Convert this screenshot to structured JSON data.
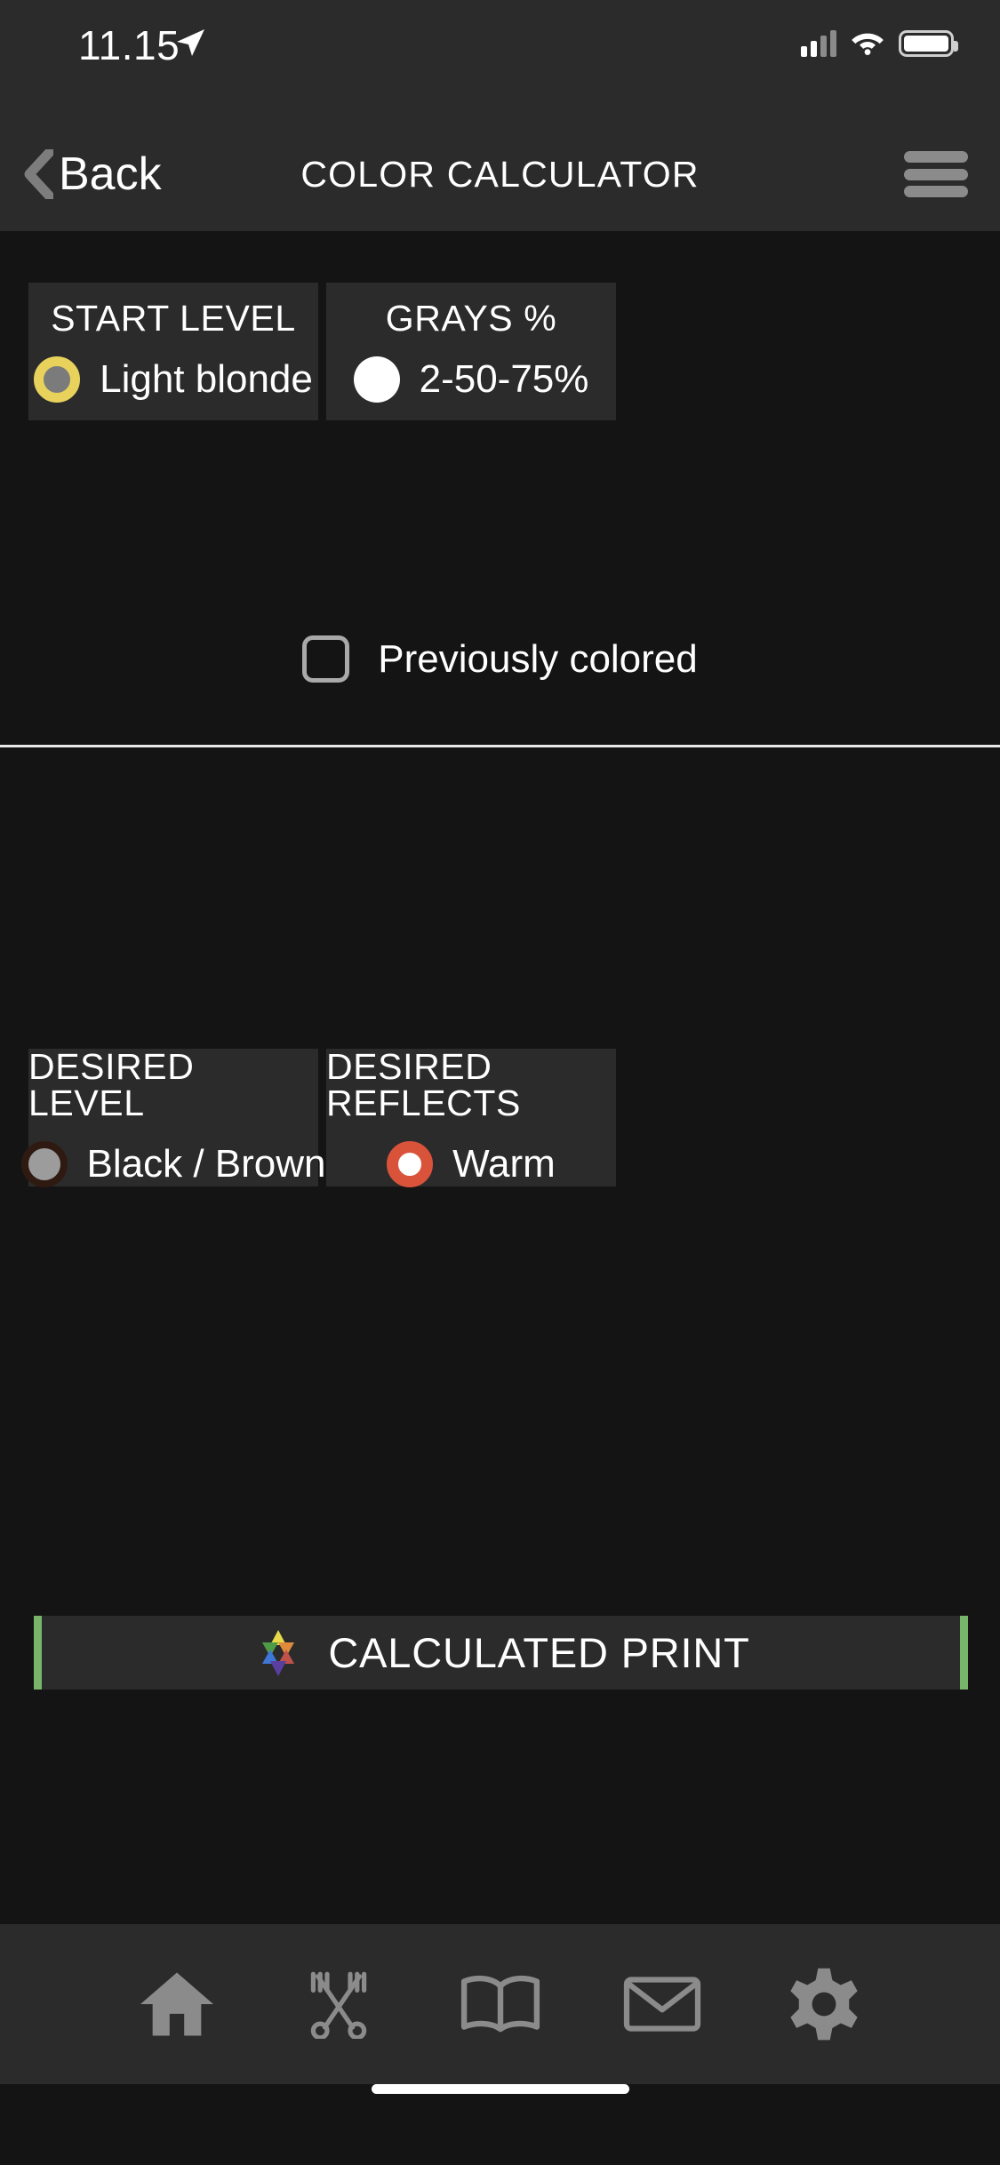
{
  "status_bar": {
    "time": "11.15",
    "location_icon": "location-arrow-icon",
    "signal_icon": "cellular-signal-icon",
    "wifi_icon": "wifi-icon",
    "battery_icon": "battery-icon"
  },
  "nav_bar": {
    "back_label": "Back",
    "back_icon": "chevron-left-icon",
    "title": "COLOR CALCULATOR",
    "menu_icon": "hamburger-menu-icon"
  },
  "start_section": {
    "cards": [
      {
        "title": "START LEVEL",
        "value": "Light blonde",
        "swatch_name": "start-level-swatch",
        "swatch_fill": "#7b7b7b",
        "swatch_ring": "#e8d25c"
      },
      {
        "title": "GRAYS %",
        "value": "2-50-75%",
        "swatch_name": "grays-percent-swatch",
        "swatch_fill": "#ffffff",
        "swatch_ring": "#ffffff"
      }
    ],
    "checkbox": {
      "label": "Previously colored",
      "checked": false
    }
  },
  "desired_section": {
    "cards": [
      {
        "title": "DESIRED LEVEL",
        "value": "Black / Brown",
        "swatch_name": "desired-level-swatch",
        "swatch_fill": "#9c9c9c",
        "swatch_ring": "#2f1a12"
      },
      {
        "title": "DESIRED REFLECTS",
        "value": "Warm",
        "swatch_name": "desired-reflects-swatch",
        "swatch_fill": "#ffffff",
        "swatch_ring": "#d9533a"
      }
    ]
  },
  "calculate_button": {
    "label": "CALCULATED PRINT",
    "icon": "color-star-icon",
    "accent_color": "#79b46b"
  },
  "tab_bar": {
    "items": [
      {
        "name": "tab-home",
        "icon": "home-icon"
      },
      {
        "name": "tab-shears",
        "icon": "scissors-icon"
      },
      {
        "name": "tab-book",
        "icon": "book-icon"
      },
      {
        "name": "tab-mail",
        "icon": "mail-icon"
      },
      {
        "name": "tab-settings",
        "icon": "gear-icon"
      }
    ]
  },
  "theme": {
    "background": "#141414",
    "card_background": "#2b2b2b",
    "bar_background": "#2b2b2c",
    "text": "#ffffff"
  }
}
